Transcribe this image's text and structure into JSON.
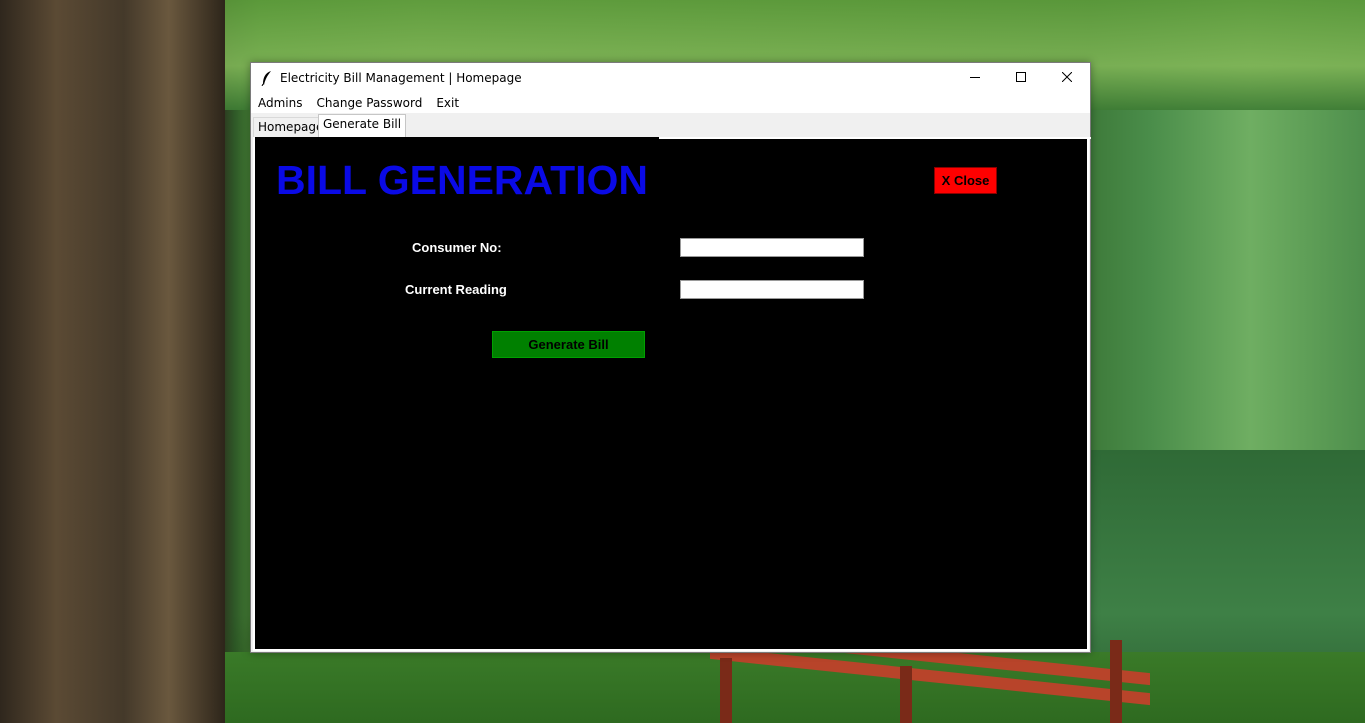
{
  "window": {
    "title": "Electricity Bill Management | Homepage"
  },
  "menu": {
    "items": [
      "Admins",
      "Change Password",
      "Exit"
    ]
  },
  "tabs": [
    {
      "label": "Homepage",
      "active": false
    },
    {
      "label": "Generate Bill",
      "active": true
    }
  ],
  "form": {
    "heading": "BILL GENERATION",
    "close_label": "X Close",
    "consumer_label": "Consumer No:",
    "consumer_value": "",
    "reading_label": "Current Reading",
    "reading_value": "",
    "generate_label": "Generate Bill"
  },
  "colors": {
    "heading": "#0a0ae6",
    "close_button": "#ff0000",
    "generate_button": "#008000",
    "panel_background": "#000000"
  },
  "icons": {
    "app": "feather-icon",
    "minimize": "minimize-icon",
    "maximize": "maximize-icon",
    "close": "close-icon"
  }
}
